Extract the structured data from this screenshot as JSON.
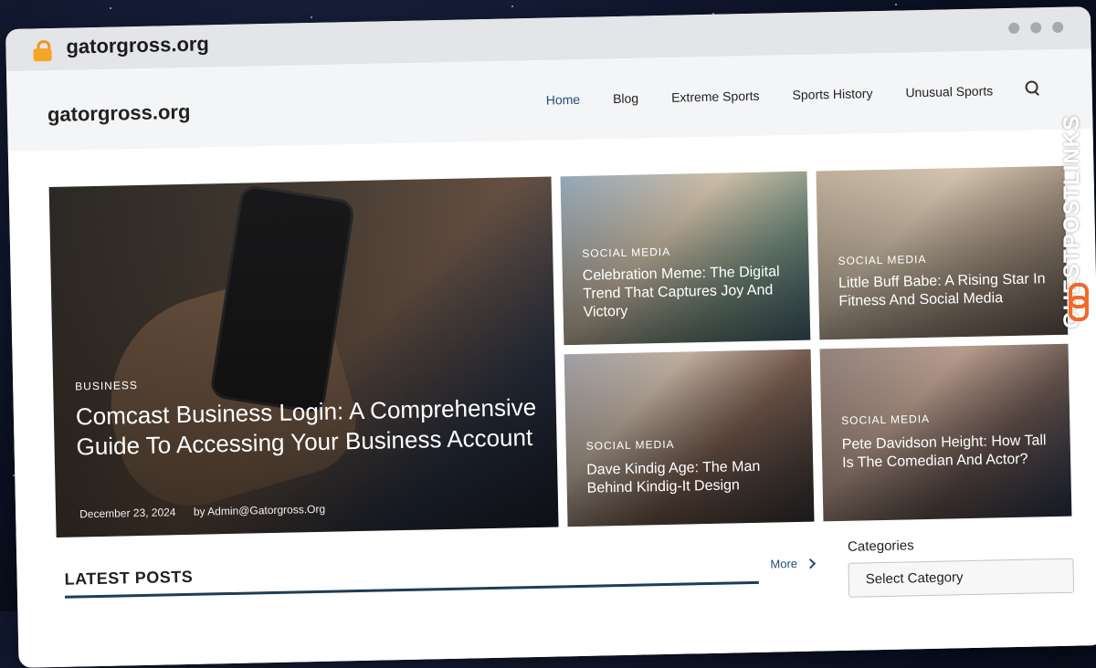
{
  "browser": {
    "url": "gatorgross.org"
  },
  "header": {
    "site_title": "gatorgross.org",
    "nav": [
      "Home",
      "Blog",
      "Extreme Sports",
      "Sports History",
      "Unusual Sports"
    ]
  },
  "featured": {
    "category": "BUSINESS",
    "title": "Comcast Business Login: A Comprehensive Guide To Accessing Your Business Account",
    "date": "December 23, 2024",
    "author": "by  Admin@Gatorgross.Org"
  },
  "cards": [
    {
      "category": "SOCIAL MEDIA",
      "title": "Celebration Meme: The Digital Trend That Captures Joy And Victory"
    },
    {
      "category": "SOCIAL MEDIA",
      "title": "Little Buff Babe: A Rising Star In Fitness And Social Media"
    },
    {
      "category": "SOCIAL MEDIA",
      "title": "Dave Kindig Age: The Man Behind Kindig-It Design"
    },
    {
      "category": "SOCIAL MEDIA",
      "title": "Pete Davidson Height: How Tall Is The Comedian And Actor?"
    }
  ],
  "latest": {
    "heading": "LATEST POSTS",
    "more_label": "More"
  },
  "sidebar": {
    "categories_label": "Categories",
    "select_value": "Select Category"
  },
  "watermark": {
    "text": "GUESTPOSTLINKS"
  },
  "colors": {
    "accent": "#1f4d7a",
    "watermark_orange": "#f06a2a",
    "lock": "#f5a623"
  }
}
